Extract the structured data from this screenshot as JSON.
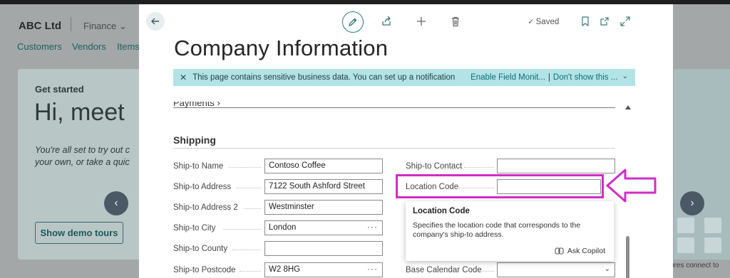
{
  "background": {
    "company": "ABC Ltd",
    "department": "Finance",
    "nav": [
      "Customers",
      "Vendors",
      "Items"
    ],
    "card_title": "Get started",
    "card_heading": "Hi, meet",
    "card_line1": "You're all set to try out c",
    "card_line2": "your own, or take a quic",
    "demo_button": "Show demo tours",
    "prev_arrow": "‹",
    "next_arrow": "›",
    "footer_snippet": "ures connect to"
  },
  "modal": {
    "toolbar": {
      "back_icon": "arrow-left-icon",
      "edit_icon": "pencil-icon",
      "share_icon": "share-icon",
      "new_icon": "plus-icon",
      "delete_icon": "trash-icon",
      "saved_label": "Saved",
      "bookmark_icon": "bookmark-icon",
      "popout_icon": "open-new-window-icon",
      "expand_icon": "expand-icon"
    },
    "title": "Company Information",
    "banner": {
      "text": "This page contains sensitive business data. You can set up a notification t...",
      "link1": "Enable Field Monit...",
      "link2": "Don't show this ..."
    },
    "prev_section": "Payments",
    "section": "Shipping",
    "left_fields": [
      {
        "label": "Ship-to Name",
        "value": "Contoso Coffee"
      },
      {
        "label": "Ship-to Address",
        "value": "7122 South Ashford Street"
      },
      {
        "label": "Ship-to Address 2",
        "value": "Westminster"
      },
      {
        "label": "Ship-to City",
        "value": "London"
      },
      {
        "label": "Ship-to County",
        "value": ""
      },
      {
        "label": "Ship-to Postcode",
        "value": "W2 8HG"
      }
    ],
    "right_fields": [
      {
        "label": "Ship-to Contact",
        "value": ""
      },
      {
        "label": "Location Code",
        "value": ""
      },
      {
        "label": "Base Calendar Code",
        "value": ""
      }
    ],
    "tooltip": {
      "title": "Location Code",
      "body": "Specifies the location code that corresponds to the company's ship-to address.",
      "copilot": "Ask Copilot"
    }
  },
  "colors": {
    "accent": "#2d7a7e",
    "banner": "#b2e3e6",
    "highlight": "#d12cc8"
  }
}
